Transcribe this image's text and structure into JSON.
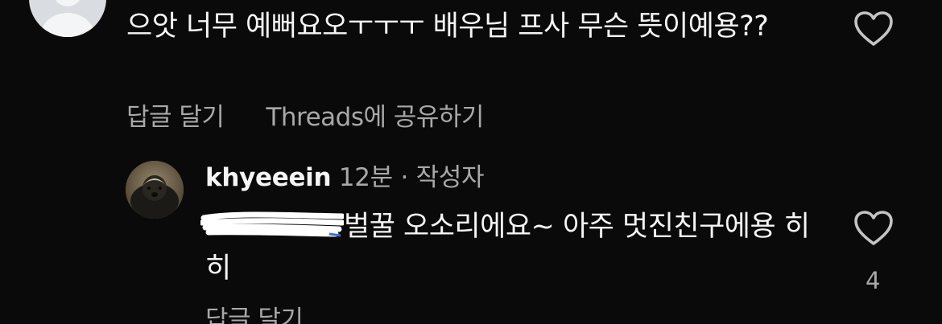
{
  "top_comment": {
    "text": "으앗 너무 예뻐요오ㅜㅜㅜ 배우님 프사 무슨 뜻이예용??",
    "actions": {
      "reply": "답글 달기",
      "share": "Threads에 공유하기"
    },
    "like_icon": "heart-outline-icon"
  },
  "reply": {
    "username": "khyeeein",
    "time": "12분",
    "separator": "·",
    "author_badge": "작성자",
    "text": "벌꿀 오소리에요~ 아주 멋진친구에용 히히",
    "like_count": "4",
    "like_icon": "heart-outline-icon",
    "actions": {
      "reply": "답글 달기"
    }
  },
  "colors": {
    "background": "#0a0a0a",
    "primary_text": "#f5f5f5",
    "secondary_text": "#a8a8a8",
    "icon": "#c4c4c4"
  }
}
